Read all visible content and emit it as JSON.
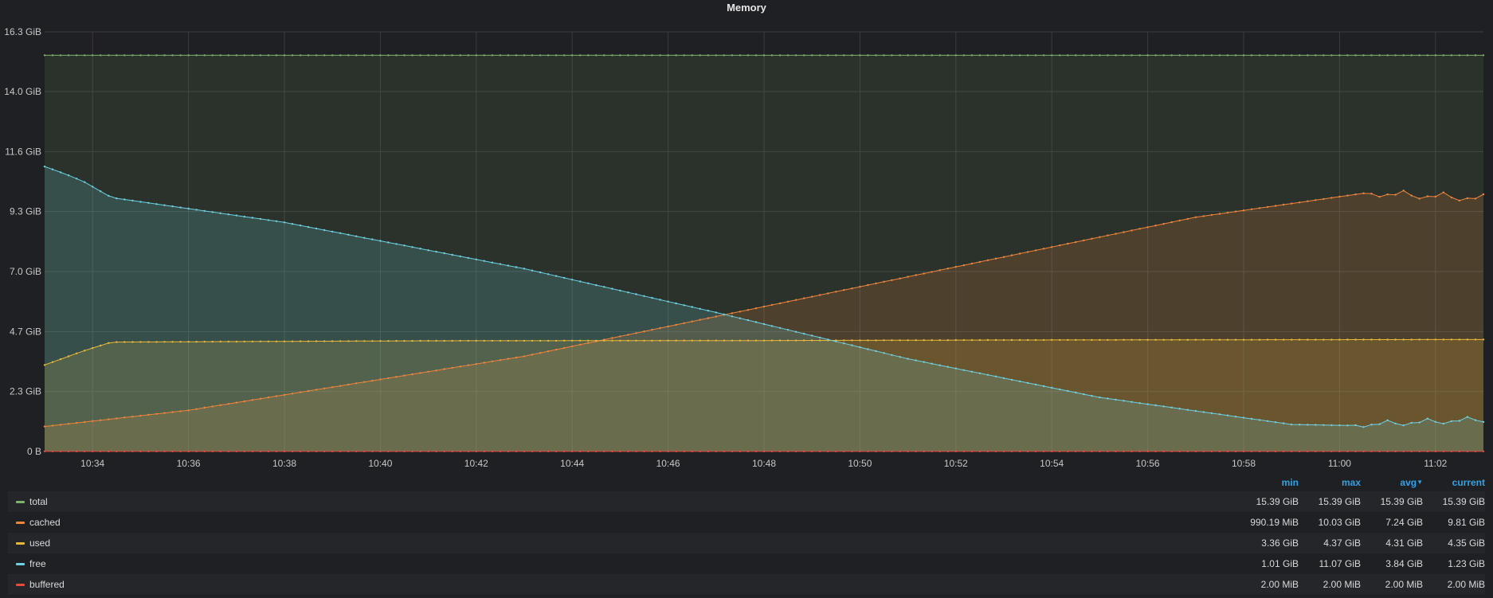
{
  "panel": {
    "title": "Memory"
  },
  "chart_data": {
    "type": "area",
    "title": "Memory",
    "x": [
      "10:34",
      "10:36",
      "10:38",
      "10:40",
      "10:42",
      "10:44",
      "10:46",
      "10:48",
      "10:50",
      "10:52",
      "10:54",
      "10:56",
      "10:58",
      "11:00",
      "11:02"
    ],
    "x_range": [
      "10:33",
      "11:03"
    ],
    "y_ticks": [
      "0 B",
      "2.3 GiB",
      "4.7 GiB",
      "7.0 GiB",
      "9.3 GiB",
      "11.6 GiB",
      "14.0 GiB",
      "16.3 GiB"
    ],
    "ylim": [
      0,
      16.3
    ],
    "y_unit": "GiB",
    "grid": true,
    "legend_placement": "bottom",
    "series": [
      {
        "name": "total",
        "color": "#7eb26d",
        "points": [
          [
            0,
            15.39
          ],
          [
            30,
            15.39
          ]
        ]
      },
      {
        "name": "cached",
        "color": "#ef843c",
        "points": [
          [
            0,
            0.97
          ],
          [
            3,
            1.6
          ],
          [
            10,
            3.7
          ],
          [
            17,
            6.4
          ],
          [
            24,
            9.1
          ],
          [
            27.5,
            10.03
          ],
          [
            30,
            9.81
          ]
        ],
        "sawtooth_from": 27.5
      },
      {
        "name": "used",
        "color": "#eab839",
        "points": [
          [
            0,
            3.36
          ],
          [
            0.8,
            3.9
          ],
          [
            1.4,
            4.25
          ],
          [
            8,
            4.3
          ],
          [
            15,
            4.31
          ],
          [
            20,
            4.33
          ],
          [
            25,
            4.34
          ],
          [
            30,
            4.35
          ]
        ]
      },
      {
        "name": "free",
        "color": "#6ed0e0",
        "points": [
          [
            0,
            11.07
          ],
          [
            0.4,
            10.8
          ],
          [
            0.8,
            10.5
          ],
          [
            1.4,
            9.86
          ],
          [
            5,
            8.9
          ],
          [
            10,
            7.1
          ],
          [
            14,
            5.4
          ],
          [
            18,
            3.6
          ],
          [
            22,
            2.1
          ],
          [
            26,
            1.05
          ],
          [
            27.2,
            1.01
          ],
          [
            30,
            1.23
          ]
        ],
        "sawtooth_from": 27.2
      },
      {
        "name": "buffered",
        "color": "#e24d42",
        "points": [
          [
            0,
            0.002
          ],
          [
            30,
            0.002
          ]
        ]
      }
    ]
  },
  "legend": {
    "headers": {
      "min": "min",
      "max": "max",
      "avg": "avg",
      "current": "current"
    },
    "sort_indicator": "caret-down-icon",
    "rows": [
      {
        "name": "total",
        "color": "#7eb26d",
        "min": "15.39 GiB",
        "max": "15.39 GiB",
        "avg": "15.39 GiB",
        "current": "15.39 GiB"
      },
      {
        "name": "cached",
        "color": "#ef843c",
        "min": "990.19 MiB",
        "max": "10.03 GiB",
        "avg": "7.24 GiB",
        "current": "9.81 GiB"
      },
      {
        "name": "used",
        "color": "#eab839",
        "min": "3.36 GiB",
        "max": "4.37 GiB",
        "avg": "4.31 GiB",
        "current": "4.35 GiB"
      },
      {
        "name": "free",
        "color": "#6ed0e0",
        "min": "1.01 GiB",
        "max": "11.07 GiB",
        "avg": "3.84 GiB",
        "current": "1.23 GiB"
      },
      {
        "name": "buffered",
        "color": "#e24d42",
        "min": "2.00 MiB",
        "max": "2.00 MiB",
        "avg": "2.00 MiB",
        "current": "2.00 MiB"
      }
    ]
  }
}
